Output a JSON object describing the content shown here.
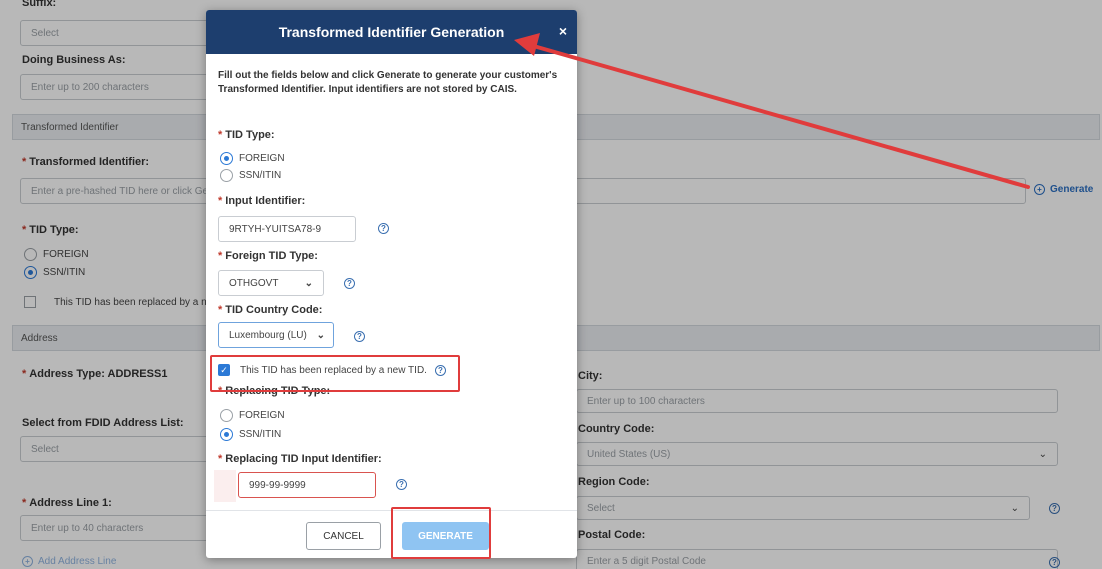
{
  "page": {
    "suffix_label": "Suffix:",
    "suffix_placeholder": "Select",
    "dba_label": "Doing Business As:",
    "dba_placeholder": "Enter up to 200 characters",
    "section_tid": "Transformed Identifier",
    "tid_label": "Transformed Identifier:",
    "tid_placeholder": "Enter a pre-hashed TID here or click Generate",
    "generate_link": "Generate",
    "tid_type_label": "TID Type:",
    "radio_foreign": "FOREIGN",
    "radio_ssn": "SSN/ITIN",
    "replaced_checkbox": "This TID has been replaced by a new TID.",
    "section_address": "Address",
    "address_type_label": "Address Type:",
    "address_type_value": "ADDRESS1",
    "fdid_label": "Select from FDID Address List:",
    "fdid_placeholder": "Select",
    "line1_label": "Address Line 1:",
    "line1_placeholder": "Enter up to 40 characters",
    "add_line": "Add Address Line",
    "city_label": "City:",
    "city_placeholder": "Enter up to 100 characters",
    "country_label": "Country Code:",
    "country_value": "United States (US)",
    "region_label": "Region Code:",
    "region_placeholder": "Select",
    "postal_label": "Postal Code:",
    "postal_placeholder": "Enter a 5 digit Postal Code"
  },
  "modal": {
    "title": "Transformed Identifier Generation",
    "close": "×",
    "intro": "Fill out the fields below and click Generate to generate your customer's Transformed Identifier. Input identifiers are not stored by CAIS.",
    "tid_type_label": "TID Type:",
    "opt_foreign": "FOREIGN",
    "opt_ssn": "SSN/ITIN",
    "input_identifier_label": "Input Identifier:",
    "input_identifier_value": "9RTYH-YUITSA78-9",
    "foreign_tid_type_label": "Foreign TID Type:",
    "foreign_tid_type_value": "OTHGOVT",
    "country_code_label": "TID Country Code:",
    "country_code_value": "Luxembourg (LU)",
    "replaced_label": "This TID has been replaced by a new TID.",
    "replacing_type_label": "Replacing TID Type:",
    "replacing_input_label": "Replacing TID Input Identifier:",
    "replacing_input_value": "999-99-9999",
    "cancel": "CANCEL",
    "generate": "GENERATE"
  },
  "colors": {
    "header": "#1d3e6e",
    "accent": "#2b79d6",
    "annotation": "#e03c3c"
  },
  "icons": [
    "close-icon",
    "help-icon",
    "chevron-down-icon",
    "check-icon",
    "plus-circle-icon",
    "arrow-annotation"
  ]
}
